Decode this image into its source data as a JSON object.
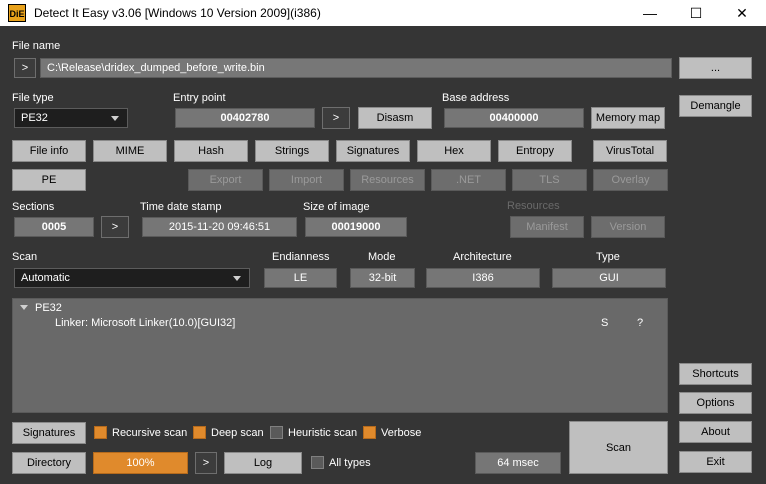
{
  "window": {
    "icon_text": "DiE",
    "title": "Detect It Easy v3.06 [Windows 10 Version 2009](i386)",
    "minimize": "—",
    "maximize": "☐",
    "close": "✕"
  },
  "file": {
    "label": "File name",
    "nav": ">",
    "path": "C:\\Release\\dridex_dumped_before_write.bin",
    "browse": "..."
  },
  "filetype": {
    "label": "File type",
    "value": "PE32"
  },
  "entry": {
    "label": "Entry point",
    "value": "00402780",
    "nav": ">",
    "disasm": "Disasm"
  },
  "base": {
    "label": "Base address",
    "value": "00400000",
    "memory_map": "Memory map"
  },
  "side": {
    "demangle": "Demangle",
    "shortcuts": "Shortcuts",
    "options": "Options",
    "about": "About",
    "exit": "Exit"
  },
  "tools": [
    "File info",
    "MIME",
    "Hash",
    "Strings",
    "Signatures",
    "Hex",
    "Entropy"
  ],
  "virustotal": "VirusTotal",
  "pe_button": "PE",
  "pe_sub": [
    "Export",
    "Import",
    "Resources",
    ".NET",
    "TLS",
    "Overlay"
  ],
  "sections": {
    "label": "Sections",
    "value": "0005",
    "nav": ">"
  },
  "timestamp": {
    "label": "Time date stamp",
    "value": "2015-11-20 09:46:51"
  },
  "image_size": {
    "label": "Size of image",
    "value": "00019000"
  },
  "resources": {
    "label": "Resources",
    "manifest": "Manifest",
    "version": "Version"
  },
  "scan": {
    "label": "Scan",
    "mode_value": "Automatic",
    "endianness_label": "Endianness",
    "endianness": "LE",
    "mode_label": "Mode",
    "mode": "32-bit",
    "arch_label": "Architecture",
    "arch": "I386",
    "type_label": "Type",
    "type": "GUI"
  },
  "results": {
    "root": "PE32",
    "items": [
      {
        "text": "Linker: Microsoft Linker(10.0)[GUI32]",
        "flag": "S",
        "info": "?"
      }
    ]
  },
  "bottom": {
    "signatures": "Signatures",
    "recursive": "Recursive scan",
    "deep": "Deep scan",
    "heuristic": "Heuristic scan",
    "verbose": "Verbose",
    "directory": "Directory",
    "progress": "100%",
    "progress_value": 1.0,
    "nav": ">",
    "log": "Log",
    "alltypes": "All types",
    "time": "64 msec",
    "scan_button": "Scan"
  }
}
